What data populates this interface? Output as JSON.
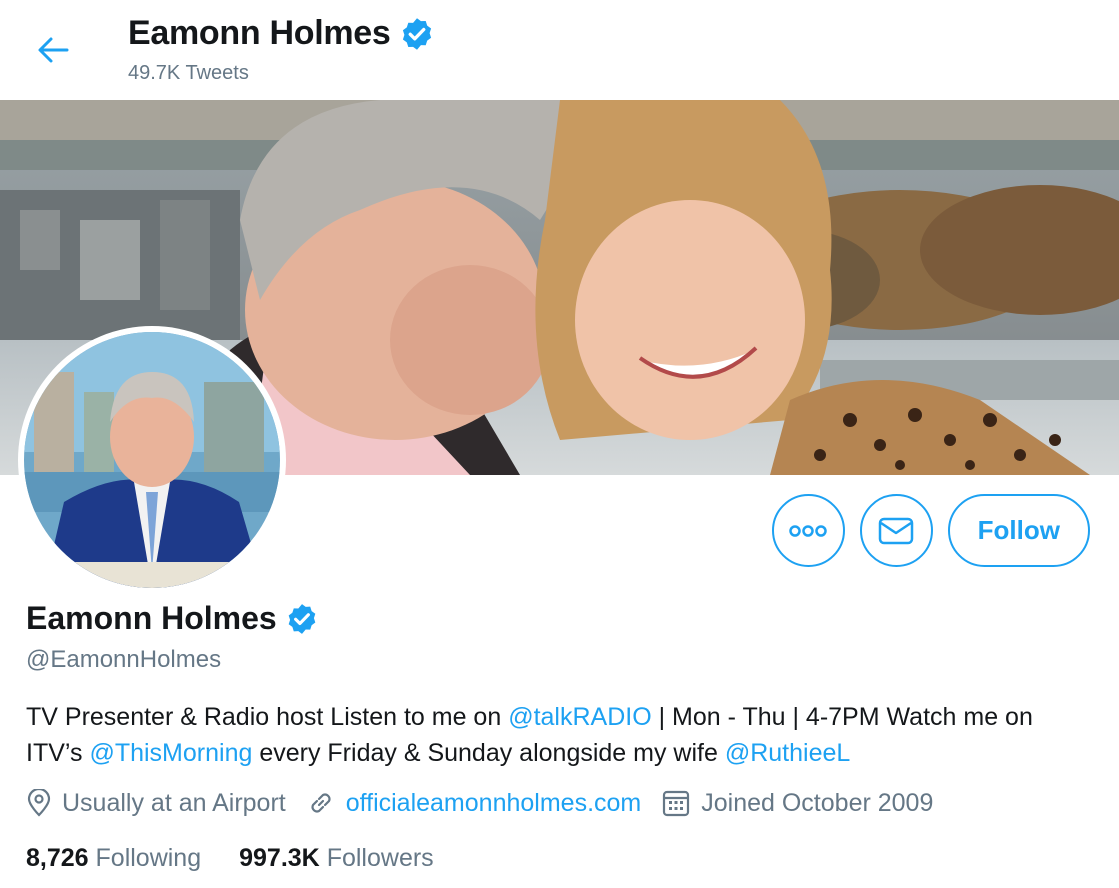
{
  "header": {
    "name": "Eamonn Holmes",
    "tweets": "49.7K Tweets"
  },
  "colors": {
    "accent": "#1da1f2",
    "verified": "#1da1f2",
    "text": "#14171a",
    "muted": "#657786"
  },
  "icons": {
    "back": "arrow-left-icon",
    "verified": "verified-badge-icon",
    "more": "more-dots-icon",
    "message": "envelope-icon",
    "location": "location-pin-icon",
    "website": "link-icon",
    "joined": "calendar-icon"
  },
  "actions": {
    "follow_label": "Follow"
  },
  "profile": {
    "name": "Eamonn Holmes",
    "handle": "@EamonnHolmes",
    "bio": {
      "part1": "TV Presenter & Radio host Listen to me on ",
      "mention1": "@talkRADIO",
      "part2": " | Mon - Thu | 4-7PM Watch me on ITV’s ",
      "mention2": "@ThisMorning",
      "part3": " every Friday & Sunday alongside my wife ",
      "mention3": "@RuthieeL"
    },
    "location": "Usually at an Airport",
    "website": "officialeamonnholmes.com",
    "joined": "Joined October 2009"
  },
  "stats": {
    "following_count": "8,726",
    "following_label": "Following",
    "followers_count": "997.3K",
    "followers_label": "Followers"
  }
}
